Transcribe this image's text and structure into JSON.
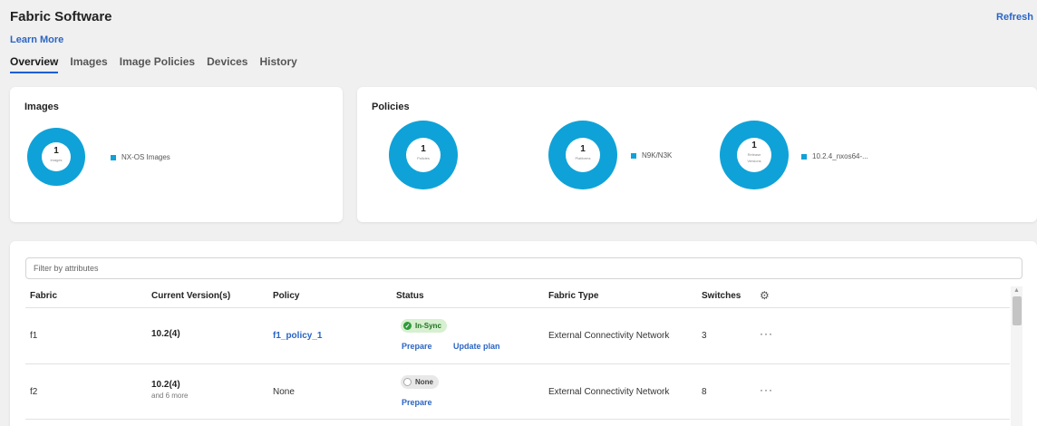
{
  "header": {
    "title": "Fabric Software",
    "refresh_label": "Refresh",
    "learn_more": "Learn More",
    "tabs": [
      {
        "label": "Overview",
        "active": true
      },
      {
        "label": "Images",
        "active": false
      },
      {
        "label": "Image Policies",
        "active": false
      },
      {
        "label": "Devices",
        "active": false
      },
      {
        "label": "History",
        "active": false
      }
    ]
  },
  "images_card": {
    "title": "Images",
    "donut": {
      "count": "1",
      "label": "Images",
      "color": "#0fa2d8"
    },
    "legend": "NX-OS Images"
  },
  "policies_card": {
    "title": "Policies",
    "donuts": [
      {
        "count": "1",
        "label": "Policies",
        "legend": ""
      },
      {
        "count": "1",
        "label": "Platforms",
        "legend": "N9K/N3K"
      },
      {
        "count": "1",
        "label": "Release",
        "label2": "Versions",
        "legend": "10.2.4_nxos64-..."
      }
    ]
  },
  "filter": {
    "placeholder": "Filter by attributes"
  },
  "table": {
    "columns": [
      "Fabric",
      "Current Version(s)",
      "Policy",
      "Status",
      "Fabric Type",
      "Switches"
    ],
    "settings_icon": "gear-icon",
    "rows": [
      {
        "fabric": "f1",
        "version": "10.2(4)",
        "version_more": "",
        "policy": "f1_policy_1",
        "status": "In-Sync",
        "actions": [
          "Prepare",
          "Update plan"
        ],
        "fabric_type": "External Connectivity Network",
        "switches": "3",
        "more": "···"
      },
      {
        "fabric": "f2",
        "version": "10.2(4)",
        "version_more": "and 6 more",
        "policy": "None",
        "status": "None",
        "actions": [
          "Prepare"
        ],
        "fabric_type": "External Connectivity Network",
        "switches": "8",
        "more": "···"
      }
    ]
  },
  "colors": {
    "accent": "#0fa2d8",
    "link": "#2b65c4",
    "in_sync": "#2e9a3a"
  }
}
